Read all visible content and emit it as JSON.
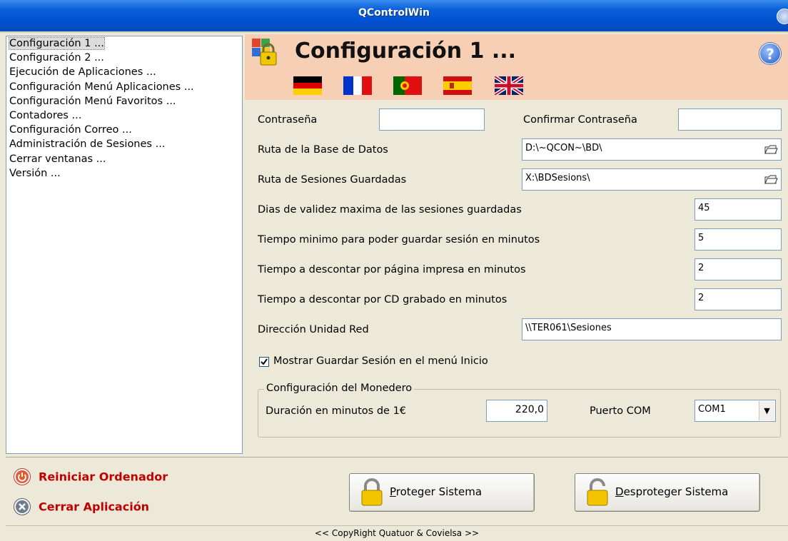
{
  "window": {
    "title": "QControlWin"
  },
  "nav": {
    "items": [
      "Configuración 1 ...",
      "Configuración 2 ...",
      "Ejecución de Aplicaciones ...",
      "Configuración Menú Aplicaciones ...",
      "Configuración Menú Favoritos ...",
      "Contadores ...",
      "Configuración Correo ...",
      "Administración de Sesiones ...",
      "Cerrar ventanas ...",
      "Versión ..."
    ],
    "selected": "Configuración 1 ..."
  },
  "header": {
    "title": "Configuración 1 ...",
    "help": "?",
    "languages": [
      "german-flag",
      "french-flag",
      "portuguese-flag",
      "spanish-flag",
      "uk-flag"
    ]
  },
  "form": {
    "password_label": "Contraseña",
    "password_value": "",
    "confirm_password_label": "Confirmar Contraseña",
    "confirm_password_value": "",
    "db_path_label": "Ruta de la Base de Datos",
    "db_path_value": "D:\\~QCON~\\BD\\",
    "sessions_path_label": "Ruta de Sesiones Guardadas",
    "sessions_path_value": "X:\\BDSesions\\",
    "max_days_label": "Dias de validez maxima de las sesiones guardadas",
    "max_days_value": "45",
    "min_time_label": "Tiempo minimo para poder guardar sesión en minutos",
    "min_time_value": "5",
    "print_discount_label": "Tiempo a descontar por página impresa en minutos",
    "print_discount_value": "2",
    "cd_discount_label": "Tiempo a descontar por CD grabado en minutos",
    "cd_discount_value": "2",
    "network_label": "Dirección Unidad Red",
    "network_value": "\\\\TER061\\Sesiones",
    "show_save_label": "Mostrar Guardar Sesión en el menú Inicio",
    "show_save_checked": true
  },
  "wallet": {
    "legend": "Configuración del Monedero",
    "duration_label": "Duración en minutos de 1€",
    "duration_value": "220,0",
    "com_label": "Puerto COM",
    "com_value": "COM1"
  },
  "actions": {
    "restart": "Reiniciar Ordenador",
    "close": "Cerrar Aplicación",
    "protect_accel": "P",
    "protect_rest": "roteger Sistema",
    "unprotect_accel": "D",
    "unprotect_rest": "esproteger Sistema"
  },
  "status": {
    "text": "<< CopyRight  Quatuor & Covielsa >>"
  },
  "colors": {
    "header_bg": "#f7cfb5",
    "action_red": "#c00000",
    "title_bar": "#0050d0"
  }
}
